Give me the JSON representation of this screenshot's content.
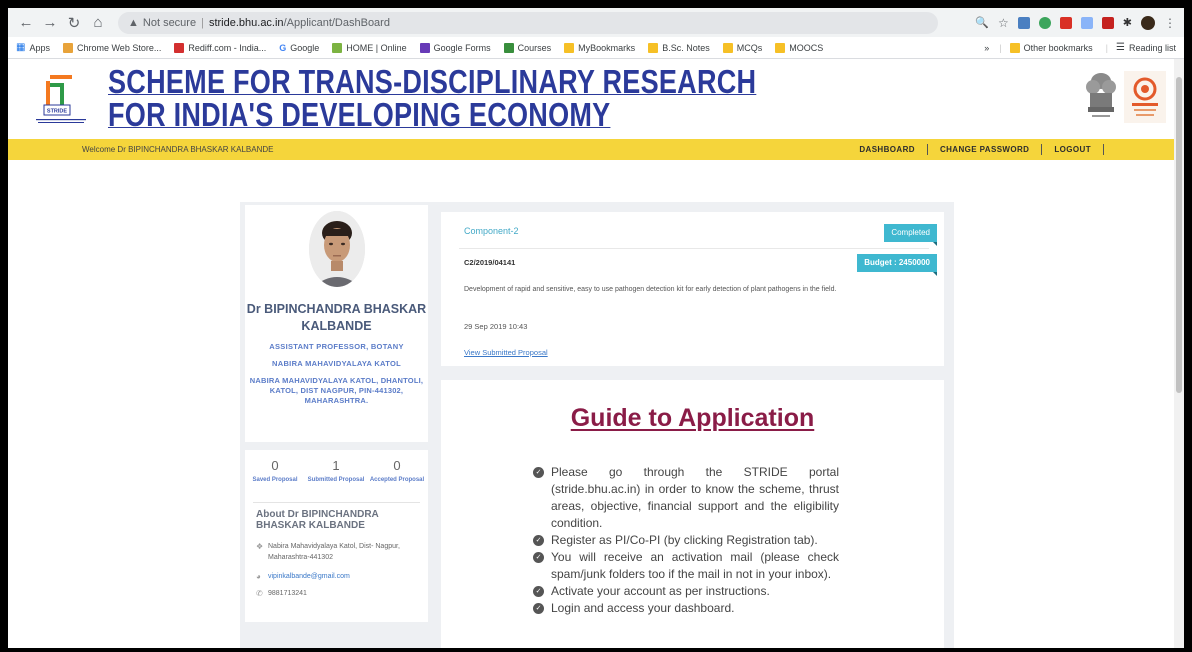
{
  "browser": {
    "security_label": "Not secure",
    "url_host": "stride.bhu.ac.in",
    "url_path": "/Applicant/DashBoard"
  },
  "bookmarks": {
    "items": [
      "Apps",
      "Chrome Web Store...",
      "Rediff.com - India...",
      "Google",
      "HOME | Online",
      "Google Forms",
      "Courses",
      "MyBookmarks",
      "B.Sc. Notes",
      "MCQs",
      "MOOCS"
    ],
    "overflow": "»",
    "other": "Other bookmarks",
    "reading_list": "Reading list"
  },
  "site": {
    "title_line1": "SCHEME FOR TRANS-DISCIPLINARY RESEARCH",
    "title_line2": "FOR INDIA'S DEVELOPING ECONOMY",
    "logo_text": "STRIDE"
  },
  "nav": {
    "welcome": "Welcome Dr BIPINCHANDRA BHASKAR KALBANDE",
    "links": [
      "DASHBOARD",
      "CHANGE PASSWORD",
      "LOGOUT"
    ]
  },
  "profile": {
    "name": "Dr BIPINCHANDRA BHASKAR KALBANDE",
    "designation": "ASSISTANT PROFESSOR, BOTANY",
    "college": "NABIRA MAHAVIDYALAYA KATOL",
    "address": "NABIRA MAHAVIDYALAYA KATOL, DHANTOLI, KATOL, DIST NAGPUR, PIN-441302, MAHARASHTRA."
  },
  "stats": {
    "saved_count": "0",
    "saved_label": "Saved Proposal",
    "submitted_count": "1",
    "submitted_label": "Submitted Proposal",
    "accepted_count": "0",
    "accepted_label": "Accepted Proposal"
  },
  "about": {
    "title": "About Dr BIPINCHANDRA BHASKAR KALBANDE",
    "address": "Nabira Mahavidyalaya Katol, Dist- Nagpur, Maharashtra-441302",
    "email": "vipinkalbande@gmail.com",
    "phone": "9881713241"
  },
  "proposal": {
    "component": "Component-2",
    "status": "Completed",
    "budget": "Budget : 2450000",
    "id": "C2/2019/04141",
    "description": "Development of rapid and sensitive, easy to use pathogen detection kit for early detection of plant pathogens in the field.",
    "date": "29 Sep 2019 10:43",
    "link": "View Submitted Proposal"
  },
  "guide": {
    "title": "Guide to Application",
    "items": [
      "Please go through the STRIDE portal (stride.bhu.ac.in) in order to know the scheme, thrust areas, objective, financial support and the eligibility condition.",
      "Register as PI/Co-PI (by clicking Registration tab).",
      "You will receive an activation mail (please check spam/junk folders too if the mail in not in your inbox).",
      "Activate your account as per instructions.",
      "Login and access your dashboard."
    ]
  },
  "colors": {
    "title_blue": "#2b3a9a",
    "nav_yellow": "#f5d53b",
    "guide_maroon": "#8a1c47",
    "ribbon_teal": "#3fb8d0"
  }
}
